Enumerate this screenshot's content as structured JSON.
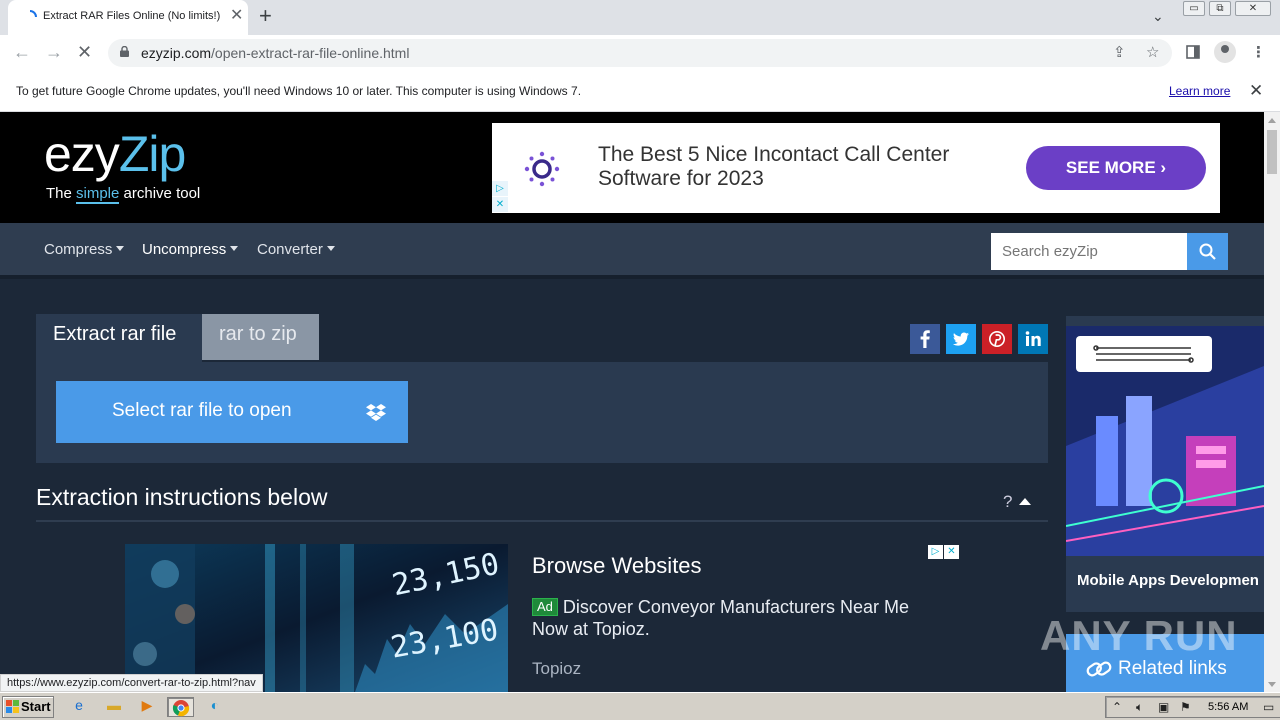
{
  "browser": {
    "tab_title": "Extract RAR Files Online (No limits!)",
    "tab_close": "✕",
    "new_tab": "+",
    "url_host": "ezyzip.com",
    "url_path": "/open-extract-rar-file-online.html",
    "infobar_text": "To get future Google Chrome updates, you'll need Windows 10 or later. This computer is using Windows 7.",
    "infobar_link": "Learn more",
    "status_url": "https://www.ezyzip.com/convert-rar-to-zip.html?nav"
  },
  "site": {
    "logo_ezy": "ezy",
    "logo_zip": "Zip",
    "tagline_pre": "The ",
    "tagline_simple": "simple",
    "tagline_post": " archive tool",
    "nav": [
      {
        "label": "Compress"
      },
      {
        "label": "Uncompress"
      },
      {
        "label": "Converter"
      }
    ],
    "search_placeholder": "Search ezyZip",
    "tabs": {
      "active": "Extract rar file",
      "inactive": "rar to zip"
    },
    "select_button": "Select rar file to open",
    "section_title": "Extraction instructions below",
    "help": "?"
  },
  "ads": {
    "top": {
      "text": "The Best 5 Nice Incontact Call Center Software for 2023",
      "button": "SEE MORE"
    },
    "mid": {
      "title": "Browse Websites",
      "badge": "Ad",
      "body": "Discover Conveyor Manufacturers Near Me Now at Topioz.",
      "source": "Topioz",
      "ticker_1": "23,150",
      "ticker_2": "23,100"
    },
    "side": {
      "text": "Mobile Apps Developmen"
    }
  },
  "related_links": "Related links",
  "watermark": "ANY RUN",
  "taskbar": {
    "start": "Start",
    "clock": "5:56 AM"
  },
  "colors": {
    "accent_blue": "#4a9ae8",
    "navbar": "#2f3d50",
    "page_bg": "#1c2838",
    "ad_button": "#6b3fc6"
  }
}
